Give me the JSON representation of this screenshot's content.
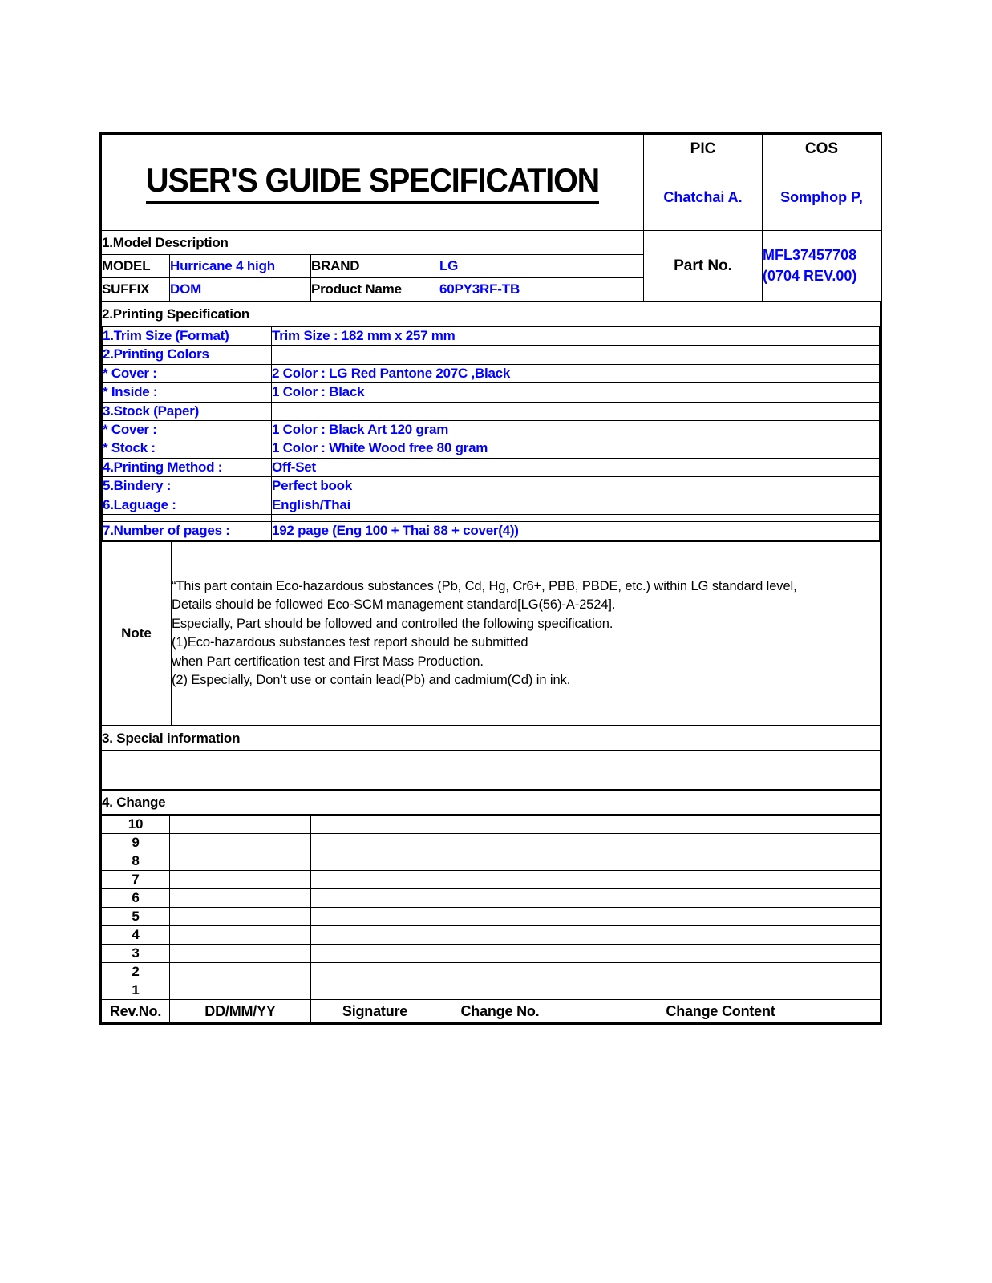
{
  "colors": {
    "text": "#000000",
    "value": "#0000ff",
    "rule": "#000000"
  },
  "header": {
    "title": "USER'S GUIDE SPECIFICATION",
    "pic_label": "PIC",
    "cos_label": "COS",
    "pic_name": "Chatchai A.",
    "cos_name": "Somphop P,",
    "part_no_label": "Part No.",
    "part_no_value": "MFL37457708",
    "part_no_rev": "(0704 REV.00)"
  },
  "model_section": {
    "heading": "1.Model Description",
    "rows": [
      {
        "label1": "MODEL",
        "value1": "Hurricane 4 high",
        "label2": "BRAND",
        "value2": "LG"
      },
      {
        "label1": "SUFFIX",
        "value1": "DOM",
        "label2": "Product Name",
        "value2": "60PY3RF-TB"
      }
    ]
  },
  "printing_section": {
    "heading": "2.Printing Specification",
    "items": [
      {
        "key": "1.Trim Size (Format)",
        "value": "Trim Size  : 182 mm x 257 mm"
      },
      {
        "key": "2.Printing Colors",
        "value": ""
      },
      {
        "key": "* Cover :",
        "value": "2 Color : LG Red Pantone 207C ,Black"
      },
      {
        "key": "* Inside :",
        "value": "1 Color : Black"
      },
      {
        "key": "3.Stock (Paper)",
        "value": ""
      },
      {
        "key": "* Cover :",
        "value": "1 Color : Black Art 120 gram"
      },
      {
        "key": "* Stock :",
        "value": "1 Color : White Wood free 80 gram"
      },
      {
        "key": "4.Printing Method :",
        "value": "Off-Set"
      },
      {
        "key": "5.Bindery :",
        "value": "Perfect book"
      },
      {
        "key": "6.Laguage :",
        "value": "English/Thai"
      },
      {
        "key": "7.Number of pages :",
        "value": "192 page (Eng 100 + Thai 88 + cover(4))"
      }
    ]
  },
  "note_section": {
    "label": "Note",
    "lines": [
      "“This part contain Eco-hazardous substances (Pb, Cd, Hg, Cr6+, PBB, PBDE, etc.) within LG standard level,",
      "Details should be followed Eco-SCM management standard[LG(56)-A-2524].",
      "Especially, Part should be followed and controlled the following specification.",
      "(1)Eco-hazardous substances test report should be submitted",
      "when Part certification test and First Mass Production.",
      "(2) Especially, Don’t use or contain lead(Pb) and cadmium(Cd) in ink."
    ]
  },
  "special_section": {
    "heading": "3. Special information",
    "content": ""
  },
  "change_section": {
    "heading": "4. Change",
    "rows": [
      {
        "no": "10",
        "date": "",
        "signature": "",
        "change_no": "",
        "content": ""
      },
      {
        "no": "9",
        "date": "",
        "signature": "",
        "change_no": "",
        "content": ""
      },
      {
        "no": "8",
        "date": "",
        "signature": "",
        "change_no": "",
        "content": ""
      },
      {
        "no": "7",
        "date": "",
        "signature": "",
        "change_no": "",
        "content": ""
      },
      {
        "no": "6",
        "date": "",
        "signature": "",
        "change_no": "",
        "content": ""
      },
      {
        "no": "5",
        "date": "",
        "signature": "",
        "change_no": "",
        "content": ""
      },
      {
        "no": "4",
        "date": "",
        "signature": "",
        "change_no": "",
        "content": ""
      },
      {
        "no": "3",
        "date": "",
        "signature": "",
        "change_no": "",
        "content": ""
      },
      {
        "no": "2",
        "date": "",
        "signature": "",
        "change_no": "",
        "content": ""
      },
      {
        "no": "1",
        "date": "",
        "signature": "",
        "change_no": "",
        "content": ""
      }
    ],
    "footer": {
      "rev_no": "Rev.No.",
      "date": "DD/MM/YY",
      "signature": "Signature",
      "change_no": "Change No.",
      "change_content": "Change Content"
    }
  }
}
